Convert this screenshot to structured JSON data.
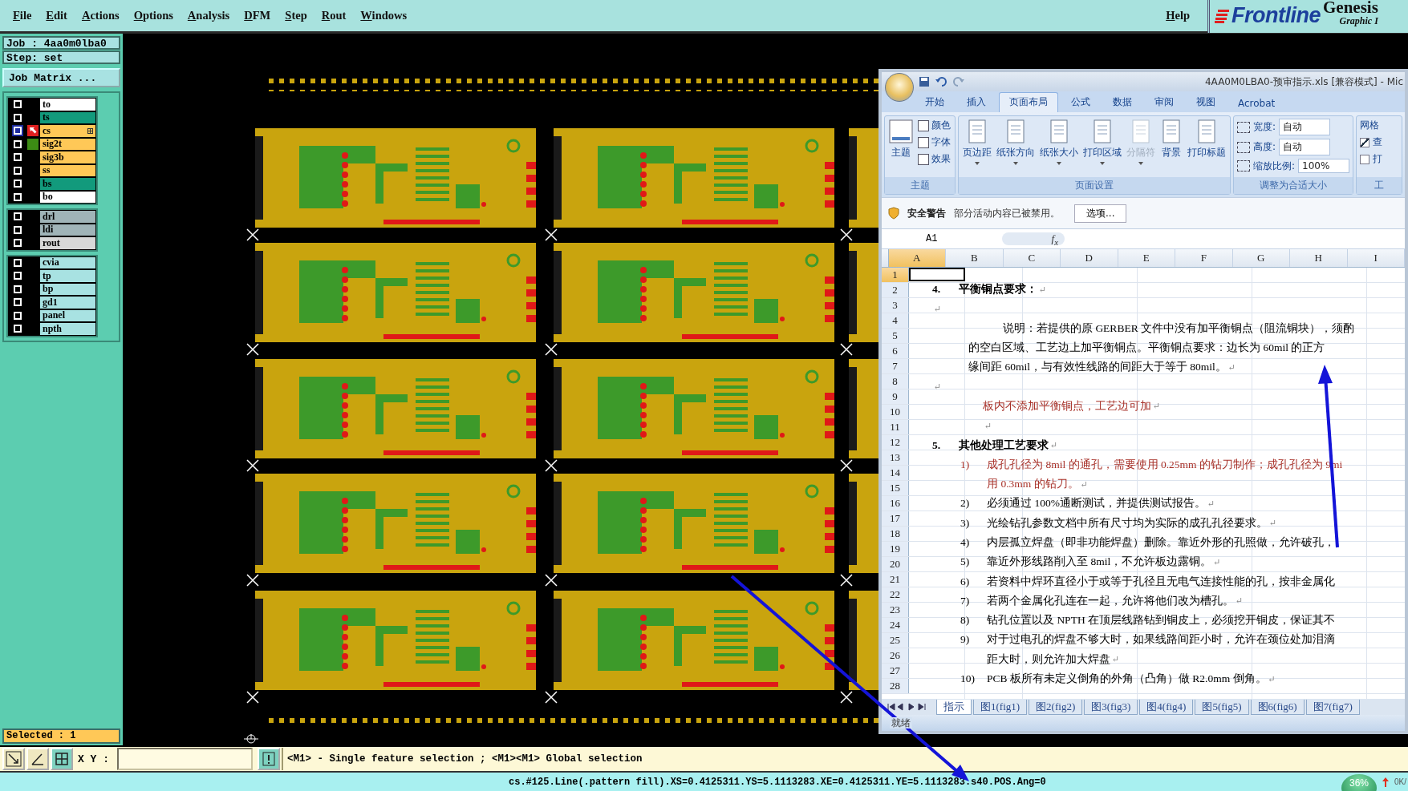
{
  "menu_bar": {
    "items": [
      "File",
      "Edit",
      "Actions",
      "Options",
      "Analysis",
      "DFM",
      "Step",
      "Rout",
      "Windows"
    ],
    "help": "Help"
  },
  "logo": {
    "brand": "Frontline",
    "product": "Genesis",
    "subtitle": "Graphic I"
  },
  "job": {
    "job": "Job : 4aa0m0lba0",
    "step": "Step: set",
    "matrix_button": "Job Matrix ..."
  },
  "layer_groups": [
    {
      "layers": [
        {
          "name": "to",
          "color": "#ffffff",
          "work": false
        },
        {
          "name": "ts",
          "color": "#129a7c",
          "work": false
        },
        {
          "name": "cs",
          "color": "#ffc857",
          "work": true
        },
        {
          "name": "sig2t",
          "color": "#ffc857",
          "work": false,
          "swatch": {
            "color": "#3c8c14"
          }
        },
        {
          "name": "sig3b",
          "color": "#ffc857",
          "work": false
        },
        {
          "name": "ss",
          "color": "#ffc857",
          "work": false
        },
        {
          "name": "bs",
          "color": "#129a7c",
          "work": false
        },
        {
          "name": "bo",
          "color": "#ffffff",
          "work": false
        }
      ]
    },
    {
      "layers": [
        {
          "name": "drl",
          "color": "#a0b4b8",
          "work": false
        },
        {
          "name": "ldi",
          "color": "#a0b4b8",
          "work": false
        },
        {
          "name": "rout",
          "color": "#d8d8d8",
          "work": false
        }
      ]
    },
    {
      "layers": [
        {
          "name": "cvia",
          "color": "#a8e2e2",
          "work": false
        },
        {
          "name": "tp",
          "color": "#a8e2e2",
          "work": false
        },
        {
          "name": "bp",
          "color": "#a8e2e2",
          "work": false
        },
        {
          "name": "gd1",
          "color": "#a8e2e2",
          "work": false
        },
        {
          "name": "panel",
          "color": "#a8e2e2",
          "work": false
        },
        {
          "name": "npth",
          "color": "#a8e2e2",
          "work": false
        }
      ]
    }
  ],
  "selected_count": "Selected : 1",
  "toolbar": {
    "xy_label": "X Y :",
    "hint": "<M1> - Single feature selection ; <M1><M1> Global selection"
  },
  "status_bar": {
    "text": "cs.#125.Line(.pattern fill).XS=0.4125311.YS=5.1113283.XE=0.4125311.YE=5.1113283.s40.POS.Ang=0",
    "zoom": "36%",
    "memory": "0K/"
  },
  "excel": {
    "title": "4AA0M0LBA0-预审指示.xls  [兼容模式]  -  Mic",
    "tabs": [
      {
        "label": "开始",
        "selected": false
      },
      {
        "label": "插入",
        "selected": false
      },
      {
        "label": "页面布局",
        "selected": true
      },
      {
        "label": "公式",
        "selected": false
      },
      {
        "label": "数据",
        "selected": false
      },
      {
        "label": "审阅",
        "selected": false
      },
      {
        "label": "视图",
        "selected": false
      },
      {
        "label": "Acrobat",
        "selected": false
      }
    ],
    "theme_group": {
      "label": "主题",
      "main": "主题",
      "options": [
        "颜色",
        "字体",
        "效果"
      ]
    },
    "page_setup": {
      "label": "页面设置",
      "buttons": [
        {
          "label": "页边距",
          "disabled": false,
          "has_menu": true
        },
        {
          "label": "纸张方向",
          "disabled": false,
          "has_menu": true
        },
        {
          "label": "纸张大小",
          "disabled": false,
          "has_menu": true
        },
        {
          "label": "打印区域",
          "disabled": false,
          "has_menu": true
        },
        {
          "label": "分隔符",
          "disabled": true,
          "has_menu": true
        },
        {
          "label": "背景",
          "disabled": false,
          "has_menu": false
        },
        {
          "label": "打印标题",
          "disabled": false,
          "has_menu": false
        }
      ]
    },
    "scale_group": {
      "label": "调整为合适大小",
      "width_label": "宽度:",
      "width": "自动",
      "height_label": "高度:",
      "height": "自动",
      "scale_label": "缩放比例:",
      "scale": "100%"
    },
    "sheet_options": {
      "label": "网格",
      "group_label": "工",
      "checks": [
        {
          "label": "查",
          "checked": true
        },
        {
          "label": "打",
          "checked": false
        }
      ]
    },
    "security": {
      "title": "安全警告",
      "message": "部分活动内容已被禁用。",
      "button": "选项..."
    },
    "name_box": "A1",
    "formula_label": "f$_{x}$",
    "columns": [
      {
        "label": "A",
        "selected": true
      },
      {
        "label": "B",
        "selected": false
      },
      {
        "label": "C",
        "selected": false
      },
      {
        "label": "D",
        "selected": false
      },
      {
        "label": "E",
        "selected": false
      },
      {
        "label": "F",
        "selected": false
      },
      {
        "label": "G",
        "selected": false
      },
      {
        "label": "H",
        "selected": false
      },
      {
        "label": "I",
        "selected": false
      }
    ],
    "rows": [
      {
        "label": "1",
        "selected": true
      },
      {
        "label": "2",
        "selected": false
      },
      {
        "label": "3",
        "selected": false
      },
      {
        "label": "4",
        "selected": false
      },
      {
        "label": "5",
        "selected": false
      },
      {
        "label": "6",
        "selected": false
      },
      {
        "label": "7",
        "selected": false
      },
      {
        "label": "8",
        "selected": false
      },
      {
        "label": "9",
        "selected": false
      },
      {
        "label": "10",
        "selected": false
      },
      {
        "label": "11",
        "selected": false
      },
      {
        "label": "12",
        "selected": false
      },
      {
        "label": "13",
        "selected": false
      },
      {
        "label": "14",
        "selected": false
      },
      {
        "label": "15",
        "selected": false
      },
      {
        "label": "16",
        "selected": false
      },
      {
        "label": "17",
        "selected": false
      },
      {
        "label": "18",
        "selected": false
      },
      {
        "label": "19",
        "selected": false
      },
      {
        "label": "20",
        "selected": false
      },
      {
        "label": "21",
        "selected": false
      },
      {
        "label": "22",
        "selected": false
      },
      {
        "label": "23",
        "selected": false
      },
      {
        "label": "24",
        "selected": false
      },
      {
        "label": "25",
        "selected": false
      },
      {
        "label": "26",
        "selected": false
      },
      {
        "label": "27",
        "selected": false
      },
      {
        "label": "28",
        "selected": false
      }
    ],
    "document": [
      {
        "kind": "heading",
        "number": "4.",
        "text": "平衡铜点要求：",
        "color": "#000000",
        "mark": "↵"
      },
      {
        "kind": "blank",
        "mark": "↵"
      },
      {
        "kind": "para_first",
        "text": "说明：若提供的原 GERBER 文件中没有加平衡铜点（阻流铜块），须酌",
        "color": "#000000"
      },
      {
        "kind": "para",
        "text": "的空白区域、工艺边上加平衡铜点。平衡铜点要求：边长为 60mil 的正方",
        "color": "#000000"
      },
      {
        "kind": "para",
        "text": "缘间距 60mil，与有效性线路的间距大于等于 80mil。",
        "color": "#000000",
        "mark": "↵"
      },
      {
        "kind": "blank",
        "mark": "↵"
      },
      {
        "kind": "note",
        "text": "板内不添加平衡铜点，工艺边可加",
        "color": "#a8322a",
        "mark": "↵"
      },
      {
        "kind": "blank_note",
        "mark": "↵"
      },
      {
        "kind": "heading",
        "number": "5.",
        "text": "其他处理工艺要求",
        "color": "#000000",
        "mark": "↵"
      },
      {
        "kind": "item",
        "number": "1)",
        "text": "成孔孔径为 8mil 的通孔，需要使用 0.25mm 的钻刀制作；成孔孔径为 9mi",
        "color": "#a8322a"
      },
      {
        "kind": "item_cont",
        "text": "用 0.3mm 的钻刀。",
        "color": "#a8322a",
        "mark": "↵"
      },
      {
        "kind": "item",
        "number": "2)",
        "text": "必须通过 100%通断测试，并提供测试报告。",
        "color": "#000000",
        "mark": "↵"
      },
      {
        "kind": "item",
        "number": "3)",
        "text": "光绘钻孔参数文档中所有尺寸均为实际的成孔孔径要求。",
        "color": "#000000",
        "mark": "↵"
      },
      {
        "kind": "item",
        "number": "4)",
        "text": "内层孤立焊盘（即非功能焊盘）删除。靠近外形的孔照做，允许破孔，",
        "color": "#000000"
      },
      {
        "kind": "item",
        "number": "5)",
        "text": "靠近外形线路削入至 8mil，不允许板边露铜。",
        "color": "#000000",
        "mark": "↵"
      },
      {
        "kind": "item",
        "number": "6)",
        "text": "若资料中焊环直径小于或等于孔径且无电气连接性能的孔，按非金属化",
        "color": "#000000"
      },
      {
        "kind": "item",
        "number": "7)",
        "text": "若两个金属化孔连在一起，允许将他们改为槽孔。",
        "color": "#000000",
        "mark": "↵"
      },
      {
        "kind": "item",
        "number": "8)",
        "text": "钻孔位置以及 NPTH 在顶层线路钻到铜皮上，必须挖开铜皮，保证其不",
        "color": "#000000"
      },
      {
        "kind": "item",
        "number": "9)",
        "text": "对于过电孔的焊盘不够大时，如果线路间距小时，允许在颈位处加泪滴",
        "color": "#000000"
      },
      {
        "kind": "item_cont",
        "text": "距大时，则允许加大焊盘",
        "color": "#000000",
        "mark": "↵"
      },
      {
        "kind": "item",
        "number": "10)",
        "text": "PCB 板所有未定义倒角的外角（凸角）做 R2.0mm 倒角。",
        "color": "#000000",
        "mark": "↵"
      }
    ],
    "sheet_tabs": [
      {
        "label": "指示",
        "selected": true
      },
      {
        "label": "图1(fig1)",
        "selected": false
      },
      {
        "label": "图2(fig2)",
        "selected": false
      },
      {
        "label": "图3(fig3)",
        "selected": false
      },
      {
        "label": "图4(fig4)",
        "selected": false
      },
      {
        "label": "图5(fig5)",
        "selected": false
      },
      {
        "label": "图6(fig6)",
        "selected": false
      },
      {
        "label": "图7(fig7)",
        "selected": false
      }
    ],
    "status": "就绪"
  }
}
